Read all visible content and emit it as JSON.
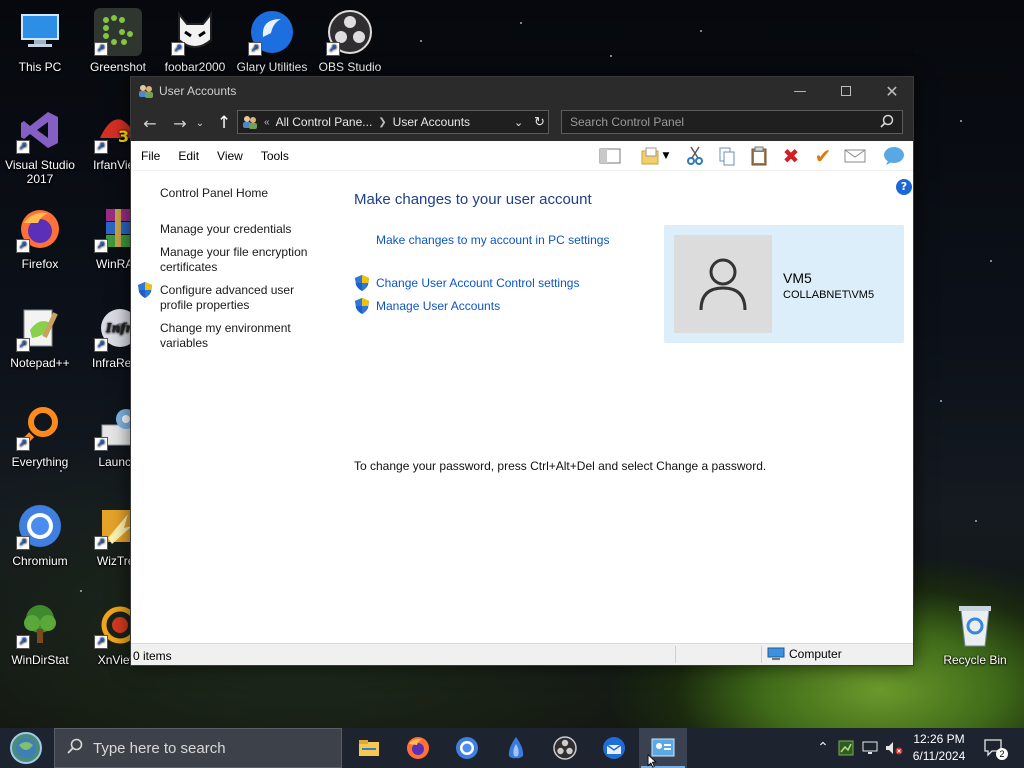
{
  "desktop": {
    "icons": [
      {
        "label": "This PC",
        "icon": "computer-icon"
      },
      {
        "label": "Greenshot",
        "icon": "greenshot-icon"
      },
      {
        "label": "foobar2000",
        "icon": "foobar2000-icon"
      },
      {
        "label": "Glary Utilities",
        "icon": "glary-utilities-icon"
      },
      {
        "label": "OBS Studio",
        "icon": "obs-studio-icon"
      },
      {
        "label": "Visual Studio 2017",
        "icon": "visual-studio-icon"
      },
      {
        "label": "IrfanView",
        "icon": "irfanview-icon"
      },
      {
        "label": "Firefox",
        "icon": "firefox-icon"
      },
      {
        "label": "WinRAR",
        "icon": "winrar-icon"
      },
      {
        "label": "Notepad++",
        "icon": "notepadpp-icon"
      },
      {
        "label": "InfraRecorder",
        "icon": "infrarecorder-icon"
      },
      {
        "label": "Everything",
        "icon": "everything-icon"
      },
      {
        "label": "Launch",
        "icon": "launch-icon"
      },
      {
        "label": "Chromium",
        "icon": "chromium-icon"
      },
      {
        "label": "WizTree",
        "icon": "wiztree-icon"
      },
      {
        "label": "WinDirStat",
        "icon": "windirstat-icon"
      },
      {
        "label": "XnView",
        "icon": "xnview-icon"
      },
      {
        "label": "Recycle Bin",
        "icon": "recycle-bin-icon"
      }
    ]
  },
  "window": {
    "title": "User Accounts",
    "address": {
      "crumb_prefix": "«",
      "crumbs": [
        "All Control Pane...",
        "User Accounts"
      ]
    },
    "search_placeholder": "Search Control Panel",
    "menu": [
      "File",
      "Edit",
      "View",
      "Tools"
    ],
    "left_nav": {
      "home": "Control Panel Home",
      "links": [
        "Manage your credentials",
        "Manage your file encryption certificates",
        "Configure advanced user profile properties",
        "Change my environment variables"
      ]
    },
    "main": {
      "heading": "Make changes to your user account",
      "pc_settings_link": "Make changes to my account in PC settings",
      "uac_link": "Change User Account Control settings",
      "manage_link": "Manage User Accounts",
      "password_note": "To change your password, press Ctrl+Alt+Del and select Change a password."
    },
    "user": {
      "name": "VM5",
      "domain": "COLLABNET\\VM5"
    },
    "help_glyph": "?",
    "status": {
      "items": "0 items",
      "zone": "Computer"
    }
  },
  "taskbar": {
    "search_placeholder": "Type here to search",
    "time": "12:26 PM",
    "date": "6/11/2024",
    "notification_count": "2"
  },
  "colors": {
    "link": "#0c55c5",
    "heading": "#1e3f8a",
    "card": "#ddeefb",
    "titlebar": "#2b2b2b",
    "taskbar": "#1d2430"
  }
}
